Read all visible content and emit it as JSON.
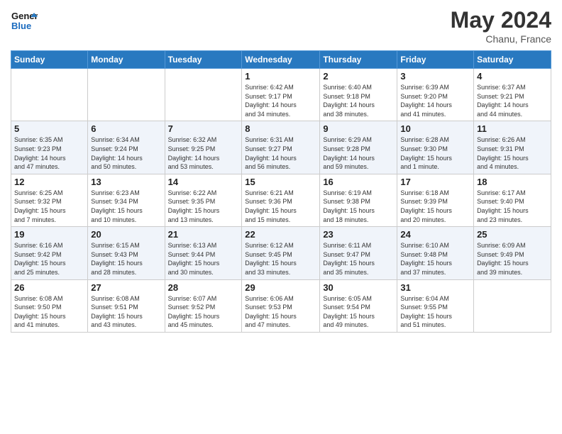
{
  "header": {
    "logo_line1": "General",
    "logo_line2": "Blue",
    "month_year": "May 2024",
    "location": "Chanu, France"
  },
  "weekdays": [
    "Sunday",
    "Monday",
    "Tuesday",
    "Wednesday",
    "Thursday",
    "Friday",
    "Saturday"
  ],
  "weeks": [
    [
      {
        "day": "",
        "content": ""
      },
      {
        "day": "",
        "content": ""
      },
      {
        "day": "",
        "content": ""
      },
      {
        "day": "1",
        "content": "Sunrise: 6:42 AM\nSunset: 9:17 PM\nDaylight: 14 hours\nand 34 minutes."
      },
      {
        "day": "2",
        "content": "Sunrise: 6:40 AM\nSunset: 9:18 PM\nDaylight: 14 hours\nand 38 minutes."
      },
      {
        "day": "3",
        "content": "Sunrise: 6:39 AM\nSunset: 9:20 PM\nDaylight: 14 hours\nand 41 minutes."
      },
      {
        "day": "4",
        "content": "Sunrise: 6:37 AM\nSunset: 9:21 PM\nDaylight: 14 hours\nand 44 minutes."
      }
    ],
    [
      {
        "day": "5",
        "content": "Sunrise: 6:35 AM\nSunset: 9:23 PM\nDaylight: 14 hours\nand 47 minutes."
      },
      {
        "day": "6",
        "content": "Sunrise: 6:34 AM\nSunset: 9:24 PM\nDaylight: 14 hours\nand 50 minutes."
      },
      {
        "day": "7",
        "content": "Sunrise: 6:32 AM\nSunset: 9:25 PM\nDaylight: 14 hours\nand 53 minutes."
      },
      {
        "day": "8",
        "content": "Sunrise: 6:31 AM\nSunset: 9:27 PM\nDaylight: 14 hours\nand 56 minutes."
      },
      {
        "day": "9",
        "content": "Sunrise: 6:29 AM\nSunset: 9:28 PM\nDaylight: 14 hours\nand 59 minutes."
      },
      {
        "day": "10",
        "content": "Sunrise: 6:28 AM\nSunset: 9:30 PM\nDaylight: 15 hours\nand 1 minute."
      },
      {
        "day": "11",
        "content": "Sunrise: 6:26 AM\nSunset: 9:31 PM\nDaylight: 15 hours\nand 4 minutes."
      }
    ],
    [
      {
        "day": "12",
        "content": "Sunrise: 6:25 AM\nSunset: 9:32 PM\nDaylight: 15 hours\nand 7 minutes."
      },
      {
        "day": "13",
        "content": "Sunrise: 6:23 AM\nSunset: 9:34 PM\nDaylight: 15 hours\nand 10 minutes."
      },
      {
        "day": "14",
        "content": "Sunrise: 6:22 AM\nSunset: 9:35 PM\nDaylight: 15 hours\nand 13 minutes."
      },
      {
        "day": "15",
        "content": "Sunrise: 6:21 AM\nSunset: 9:36 PM\nDaylight: 15 hours\nand 15 minutes."
      },
      {
        "day": "16",
        "content": "Sunrise: 6:19 AM\nSunset: 9:38 PM\nDaylight: 15 hours\nand 18 minutes."
      },
      {
        "day": "17",
        "content": "Sunrise: 6:18 AM\nSunset: 9:39 PM\nDaylight: 15 hours\nand 20 minutes."
      },
      {
        "day": "18",
        "content": "Sunrise: 6:17 AM\nSunset: 9:40 PM\nDaylight: 15 hours\nand 23 minutes."
      }
    ],
    [
      {
        "day": "19",
        "content": "Sunrise: 6:16 AM\nSunset: 9:42 PM\nDaylight: 15 hours\nand 25 minutes."
      },
      {
        "day": "20",
        "content": "Sunrise: 6:15 AM\nSunset: 9:43 PM\nDaylight: 15 hours\nand 28 minutes."
      },
      {
        "day": "21",
        "content": "Sunrise: 6:13 AM\nSunset: 9:44 PM\nDaylight: 15 hours\nand 30 minutes."
      },
      {
        "day": "22",
        "content": "Sunrise: 6:12 AM\nSunset: 9:45 PM\nDaylight: 15 hours\nand 33 minutes."
      },
      {
        "day": "23",
        "content": "Sunrise: 6:11 AM\nSunset: 9:47 PM\nDaylight: 15 hours\nand 35 minutes."
      },
      {
        "day": "24",
        "content": "Sunrise: 6:10 AM\nSunset: 9:48 PM\nDaylight: 15 hours\nand 37 minutes."
      },
      {
        "day": "25",
        "content": "Sunrise: 6:09 AM\nSunset: 9:49 PM\nDaylight: 15 hours\nand 39 minutes."
      }
    ],
    [
      {
        "day": "26",
        "content": "Sunrise: 6:08 AM\nSunset: 9:50 PM\nDaylight: 15 hours\nand 41 minutes."
      },
      {
        "day": "27",
        "content": "Sunrise: 6:08 AM\nSunset: 9:51 PM\nDaylight: 15 hours\nand 43 minutes."
      },
      {
        "day": "28",
        "content": "Sunrise: 6:07 AM\nSunset: 9:52 PM\nDaylight: 15 hours\nand 45 minutes."
      },
      {
        "day": "29",
        "content": "Sunrise: 6:06 AM\nSunset: 9:53 PM\nDaylight: 15 hours\nand 47 minutes."
      },
      {
        "day": "30",
        "content": "Sunrise: 6:05 AM\nSunset: 9:54 PM\nDaylight: 15 hours\nand 49 minutes."
      },
      {
        "day": "31",
        "content": "Sunrise: 6:04 AM\nSunset: 9:55 PM\nDaylight: 15 hours\nand 51 minutes."
      },
      {
        "day": "",
        "content": ""
      }
    ]
  ]
}
